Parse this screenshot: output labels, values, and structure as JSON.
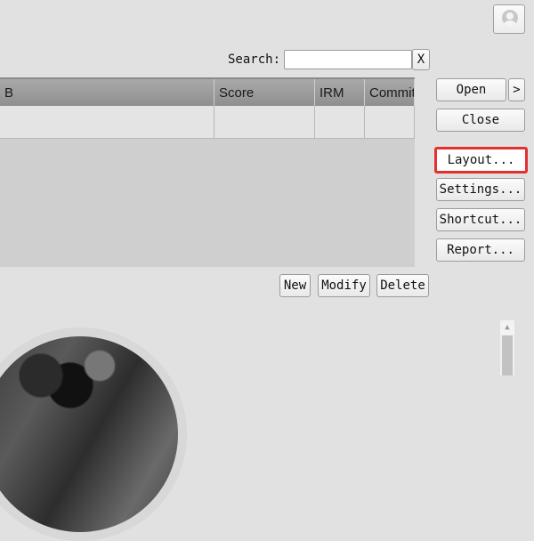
{
  "search": {
    "label": "Search:",
    "value": "",
    "placeholder": "",
    "clear_label": "X"
  },
  "table": {
    "columns": [
      "B",
      "Score",
      "IRM",
      "Commit"
    ],
    "rows": [
      [
        "",
        "",
        "",
        ""
      ]
    ]
  },
  "sidebar_buttons": {
    "open": "Open",
    "open_more": ">",
    "close": "Close",
    "layout": "Layout...",
    "settings": "Settings...",
    "shortcut": "Shortcut...",
    "report": "Report..."
  },
  "actions": {
    "new": "New",
    "modify": "Modify",
    "delete": "Delete"
  },
  "icons": {
    "user": "user-avatar-icon",
    "scroll_up": "triangle-up"
  },
  "colors": {
    "highlight": "#e53030",
    "header_bg": "#9c9c9c",
    "background": "#e1e1e1"
  }
}
